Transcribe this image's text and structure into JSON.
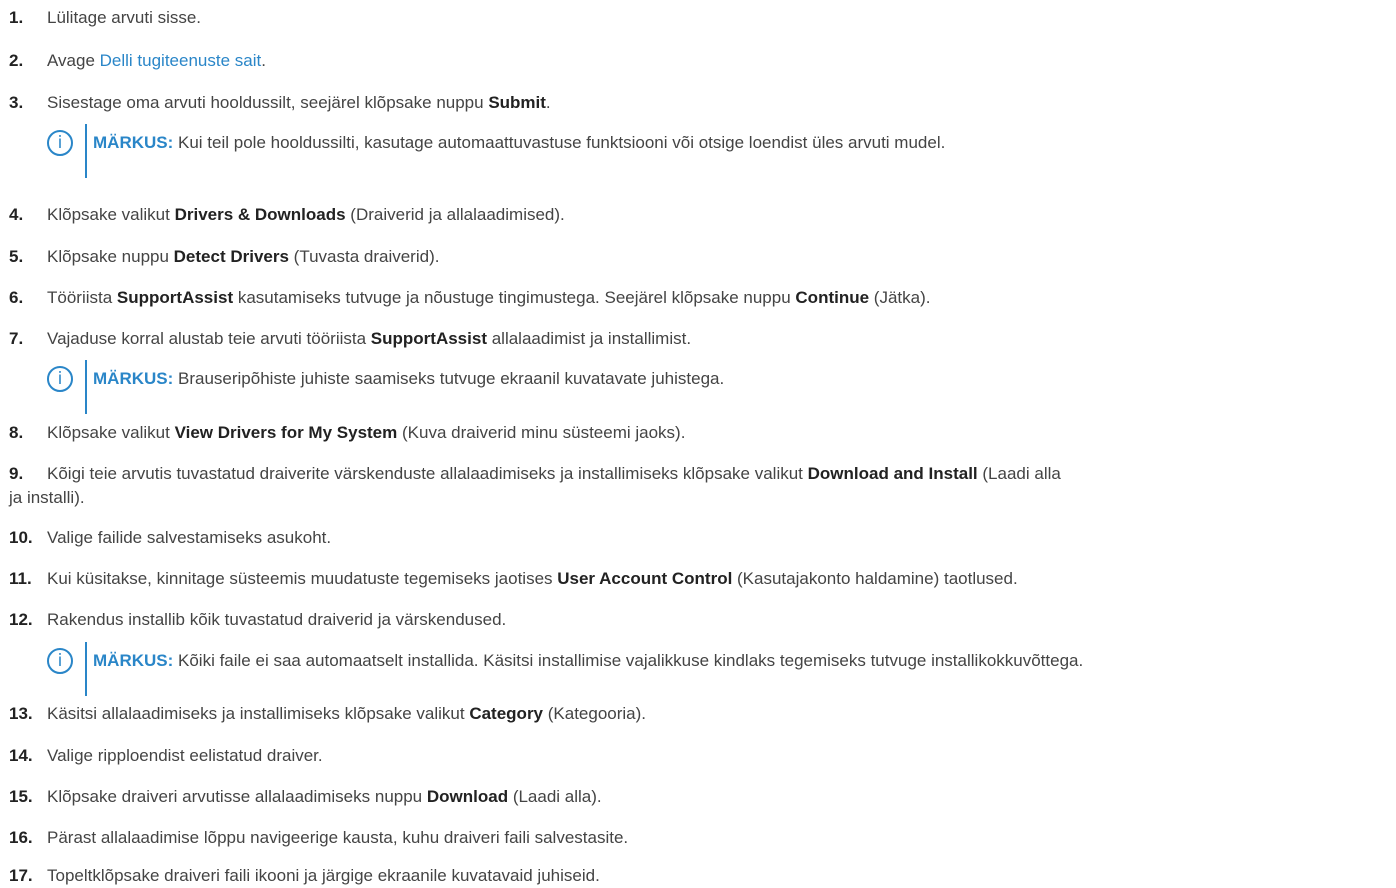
{
  "steps": [
    {
      "n": "1.",
      "text": "Lülitage arvuti sisse."
    },
    {
      "n": "2.",
      "pre": "Avage ",
      "link": "Delli tugiteenuste sait",
      "post": "."
    },
    {
      "n": "3.",
      "pre": "Sisestage oma arvuti hooldussilt, seejärel klõpsake nuppu ",
      "bold": "Submit",
      "post": "."
    },
    {
      "n": "4.",
      "pre": "Klõpsake valikut ",
      "bold": "Drivers & Downloads",
      "post": " (Draiverid ja allalaadimised)."
    },
    {
      "n": "5.",
      "pre": "Klõpsake nuppu ",
      "bold": "Detect Drivers",
      "post": " (Tuvasta draiverid)."
    },
    {
      "n": "6.",
      "pre": "Tööriista ",
      "bold": "SupportAssist",
      "mid": " kasutamiseks tutvuge ja nõustuge tingimustega. Seejärel klõpsake nuppu ",
      "bold2": "Continue",
      "post": " (Jätka)."
    },
    {
      "n": "7.",
      "pre": "Vajaduse korral alustab teie arvuti tööriista ",
      "bold": "SupportAssist",
      "post": " allalaadimist ja installimist."
    },
    {
      "n": "8.",
      "pre": "Klõpsake valikut ",
      "bold": "View Drivers for My System",
      "post": " (Kuva draiverid minu süsteemi jaoks)."
    },
    {
      "n": "9.",
      "pre": "Kõigi teie arvutis tuvastatud draiverite värskenduste allalaadimiseks ja installimiseks klõpsake valikut ",
      "bold": "Download and Install",
      "post": " (Laadi alla",
      "line2": "ja installi)."
    },
    {
      "n": "10.",
      "text": "Valige failide salvestamiseks asukoht."
    },
    {
      "n": "11.",
      "pre": "Kui küsitakse, kinnitage süsteemis muudatuste tegemiseks jaotises ",
      "bold": "User Account Control",
      "post": " (Kasutajakonto haldamine) taotlused."
    },
    {
      "n": "12.",
      "text": "Rakendus installib kõik tuvastatud draiverid ja värskendused."
    },
    {
      "n": "13.",
      "pre": "Käsitsi allalaadimiseks ja installimiseks klõpsake valikut ",
      "bold": "Category",
      "post": " (Kategooria)."
    },
    {
      "n": "14.",
      "text": "Valige ripploendist eelistatud draiver."
    },
    {
      "n": "15.",
      "pre": "Klõpsake draiveri arvutisse allalaadimiseks nuppu ",
      "bold": "Download",
      "post": " (Laadi alla)."
    },
    {
      "n": "16.",
      "text": "Pärast allalaadimise lõppu navigeerige kausta, kuhu draiveri faili salvestasite."
    },
    {
      "n": "17.",
      "text": "Topeltklõpsake draiveri faili ikooni ja järgige ekraanile kuvatavaid juhiseid."
    }
  ],
  "notes": [
    {
      "label": "MÄRKUS:",
      "text": " Kui teil pole hooldussilti, kasutage automaattuvastuse funktsiooni või otsige loendist üles arvuti mudel."
    },
    {
      "label": "MÄRKUS:",
      "text": " Brauseripõhiste juhiste saamiseks tutvuge ekraanil kuvatavate juhistega."
    },
    {
      "label": "MÄRKUS:",
      "text": " Kõiki faile ei saa automaatselt installida. Käsitsi installimise vajalikkuse kindlaks tegemiseks tutvuge installikokkuvõttega."
    }
  ],
  "icons": {
    "info": "info-icon",
    "info_glyph": "i"
  },
  "colors": {
    "accent": "#2a86c8",
    "text": "#444444",
    "bold": "#222222"
  }
}
